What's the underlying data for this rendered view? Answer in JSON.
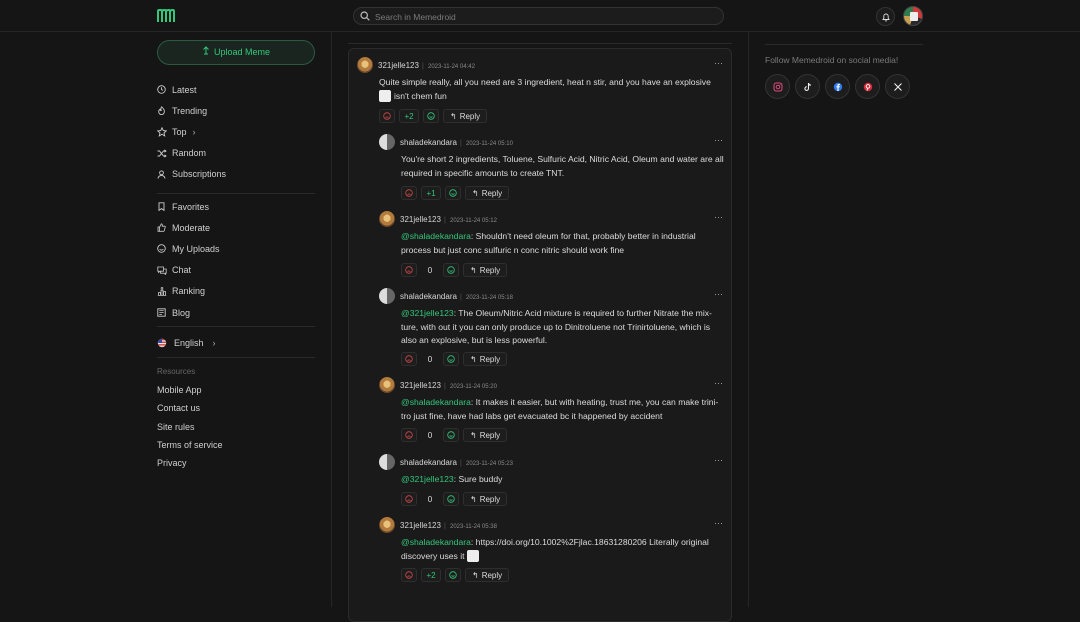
{
  "header": {
    "search_placeholder": "Search in Memedroid"
  },
  "sidebar": {
    "upload_label": "Upload Meme",
    "nav_main": [
      {
        "label": "Latest",
        "icon": "clock-icon"
      },
      {
        "label": "Trending",
        "icon": "flame-icon"
      },
      {
        "label": "Top",
        "icon": "star-icon",
        "chevron": true
      },
      {
        "label": "Random",
        "icon": "shuffle-icon"
      },
      {
        "label": "Subscriptions",
        "icon": "user-icon"
      }
    ],
    "nav_user": [
      {
        "label": "Favorites",
        "icon": "bookmark-icon"
      },
      {
        "label": "Moderate",
        "icon": "thumbs-up-icon"
      },
      {
        "label": "My Uploads",
        "icon": "smile-icon"
      },
      {
        "label": "Chat",
        "icon": "chat-icon"
      },
      {
        "label": "Ranking",
        "icon": "ranking-icon"
      },
      {
        "label": "Blog",
        "icon": "blog-icon"
      }
    ],
    "language": "English",
    "resources_title": "Resources",
    "resources": [
      "Mobile App",
      "Contact us",
      "Site rules",
      "Terms of service",
      "Privacy"
    ]
  },
  "comments": [
    {
      "user": "321jelle123",
      "time": "2023-11-24 04:42",
      "avatar": "a",
      "text_lines": [
        "Quite simple really, all you need are 3 ingredient, heat n stir, and you have an explosive",
        "isn't chem fun"
      ],
      "score": "+2",
      "reply": "Reply"
    },
    {
      "user": "shaladekandara",
      "time": "2023-11-24 05:10",
      "avatar": "b",
      "text_lines": [
        "You're short 2 ingredients, Toluene, Sulfuric Acid, Nitric Acid, Oleum and water are all",
        "required in specific amounts to create TNT."
      ],
      "score": "+1",
      "reply": "Reply"
    },
    {
      "user": "321jelle123",
      "time": "2023-11-24 05:12",
      "avatar": "a",
      "mention": "@shaladekandara",
      "text_lines": [
        ": Shouldn't need oleum for that, probably better in industrial",
        "process but just conc sulfuric n conc nitric should work fine"
      ],
      "score": "0",
      "reply": "Reply"
    },
    {
      "user": "shaladekandara",
      "time": "2023-11-24 05:18",
      "avatar": "b",
      "mention": "@321jelle123",
      "text_lines": [
        ": The Oleum/Nitric Acid mixture is required to further Nitrate the mix-",
        "ture, with out it you can only produce up to Dinitroluene not Trinirtoluene, which is",
        "also an explosive, but is less powerful."
      ],
      "score": "0",
      "reply": "Reply"
    },
    {
      "user": "321jelle123",
      "time": "2023-11-24 05:20",
      "avatar": "a",
      "mention": "@shaladekandara",
      "text_lines": [
        ": It makes it easier, but with heating, trust me, you can make trini-",
        "tro just fine, have had labs get evacuated bc it happened by accident"
      ],
      "score": "0",
      "reply": "Reply"
    },
    {
      "user": "shaladekandara",
      "time": "2023-11-24 05:23",
      "avatar": "b",
      "mention": "@321jelle123",
      "text_lines": [
        ": Sure buddy"
      ],
      "score": "0",
      "reply": "Reply"
    },
    {
      "user": "321jelle123",
      "time": "2023-11-24 05:38",
      "avatar": "a",
      "mention": "@shaladekandara",
      "text_lines": [
        ": https://doi.org/10.1002%2Fjlac.18631280206 Literally original",
        "discovery uses it"
      ],
      "score": "+2",
      "reply": "Reply"
    }
  ],
  "social": {
    "title": "Follow Memedroid on social media!",
    "networks": [
      "instagram-icon",
      "tiktok-icon",
      "facebook-icon",
      "pinterest-icon",
      "x-icon"
    ]
  },
  "colors": {
    "accent": "#34c77b",
    "background": "#151515",
    "card": "#1a1a1a",
    "downvote": "#d04848"
  }
}
